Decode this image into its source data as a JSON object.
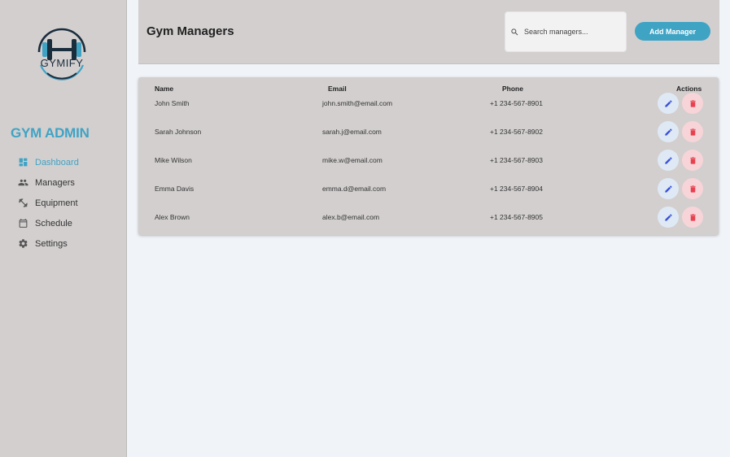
{
  "brand": {
    "logo_text": "GYMIFY",
    "title": "GYM ADMIN",
    "accent_color": "#3fa3c4"
  },
  "sidebar": {
    "items": [
      {
        "label": "Dashboard",
        "icon": "dashboard-icon",
        "active": true
      },
      {
        "label": "Managers",
        "icon": "people-icon",
        "active": false
      },
      {
        "label": "Equipment",
        "icon": "dumbbell-icon",
        "active": false
      },
      {
        "label": "Schedule",
        "icon": "calendar-icon",
        "active": false
      },
      {
        "label": "Settings",
        "icon": "gear-icon",
        "active": false
      }
    ]
  },
  "header": {
    "title": "Gym Managers",
    "search": {
      "placeholder": "Search managers...",
      "value": "",
      "icon": "search-icon"
    },
    "add_button_label": "Add Manager"
  },
  "table": {
    "columns": {
      "name": "Name",
      "email": "Email",
      "phone": "Phone",
      "actions": "Actions"
    },
    "rows": [
      {
        "name": "John Smith",
        "email": "john.smith@email.com",
        "phone": "+1 234-567-8901"
      },
      {
        "name": "Sarah Johnson",
        "email": "sarah.j@email.com",
        "phone": "+1 234-567-8902"
      },
      {
        "name": "Mike Wilson",
        "email": "mike.w@email.com",
        "phone": "+1 234-567-8903"
      },
      {
        "name": "Emma Davis",
        "email": "emma.d@email.com",
        "phone": "+1 234-567-8904"
      },
      {
        "name": "Alex Brown",
        "email": "alex.b@email.com",
        "phone": "+1 234-567-8905"
      }
    ],
    "row_actions": {
      "edit_icon": "pencil-icon",
      "delete_icon": "trash-icon"
    }
  },
  "colors": {
    "edit_icon": "#3a50d9",
    "delete_icon": "#e8404f",
    "panel_bg": "#d3cfcf",
    "page_bg": "#f0f3f8"
  }
}
